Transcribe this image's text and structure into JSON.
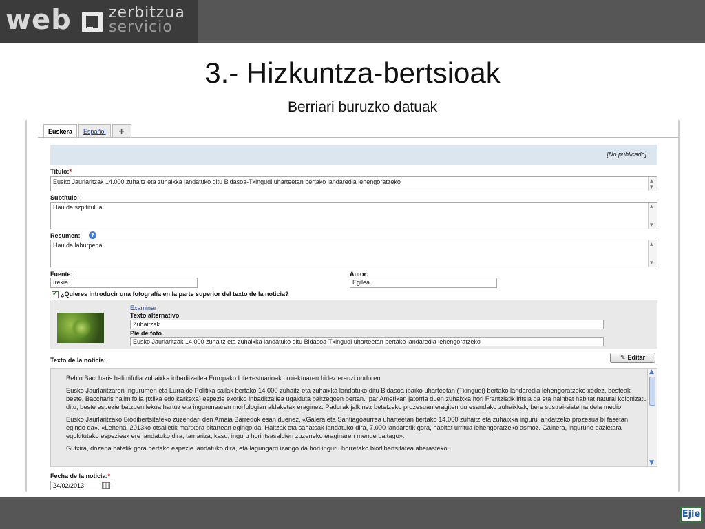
{
  "logo": {
    "web": "web",
    "line1": "zerbitzua",
    "line2": "servicio"
  },
  "slide": {
    "title": "3.- Hizkuntza-bertsioak",
    "subtitle": "Berriari buruzko datuak"
  },
  "tabs": [
    {
      "label": "Euskera",
      "active": true
    },
    {
      "label": "Español",
      "active": false
    },
    {
      "label": "+",
      "active": false
    }
  ],
  "status": "[No publicado]",
  "form": {
    "titulo_label": "Título:",
    "titulo_value": "Eusko Jaurlaritzak 14.000 zuhaitz eta zuhaixka landatuko ditu Bidasoa-Txingudi uharteetan bertako landaredia lehengoratzeko",
    "subtitulo_label": "Subtítulo:",
    "subtitulo_value": "Hau da szpititulua",
    "resumen_label": "Resumen:",
    "resumen_value": "Hau da laburpena",
    "fuente_label": "Fuente:",
    "fuente_value": "Irekia",
    "autor_label": "Autor:",
    "autor_value": "Egilea",
    "photo_question": "¿Quieres introducir una fotografía en la parte superior del texto de la noticia?",
    "examinar": "Examinar",
    "alt_label": "Texto alternativo",
    "alt_value": "Zuhaitzak",
    "pie_label": "Pie de foto",
    "pie_value": "Eusko Jaurlaritzak 14.000 zuhaitz eta zuhaixka landatuko ditu Bidasoa-Txingudi uharteetan bertako landaredia lehengoratzeko",
    "texto_label": "Texto de la noticia:",
    "editar": "Editar",
    "fecha_label": "Fecha de la noticia:",
    "fecha_value": "24/02/2013",
    "required_mark": "*"
  },
  "body_text": {
    "p1": "Behin Baccharis halimifolia zuhaixka inbaditzailea Europako Life+estuarioak proiektuaren bidez erauzi ondoren",
    "p2": "Eusko Jaurlaritzaren Ingurumen eta Lurralde Politika sailak bertako 14.000 zuhaitz eta zuhaixka landatuko ditu Bidasoa ibaiko uharteetan (Txingudi) bertako landaredia lehengoratzeko xedez, besteak beste, Baccharis halimifolia (txilka edo karkexa) espezie exotiko inbaditzailea ugalduta baitzegoen bertan. Ipar Amerikan jatorria duen zuhaixka hori Frantziatik iritsia da eta hainbat habitat natural kolonizatu ditu, beste espezie batzuen lekua hartuz eta ingurunearen morfologian aldaketak eraginez. Padurak jalkinez betetzeko prozesuan eragiten du esandako zuhaixkak, bere sustrai-sistema dela medio.",
    "p3": "Eusko Jaurlaritzako Biodibertsitateko zuzendari den Amaia Barredok esan duenez, «Galera eta Santiagoaurrea uharteetan bertako 14.000 zuhaitz eta zuhaixka inguru landatzeko prozesua bi fasetan egingo da». «Lehena, 2013ko otsailetik martxora bitartean egingo da. Haltzak eta sahatsak landatuko dira, 7.000 landaretik gora, habitat urritua lehengoratzeko asmoz. Gainera, ingurune gazietara egokitutako espezieak ere landatuko dira, tamariza, kasu, inguru hori itsasaldien zuzeneko eraginaren mende baitago».",
    "p4": "Gutxira, dozena batetik gora bertako espezie landatuko dira, eta lagungarri izango da hori inguru horretako biodibertsitatea aberasteko."
  },
  "footer": {
    "brand": "Ejie"
  }
}
